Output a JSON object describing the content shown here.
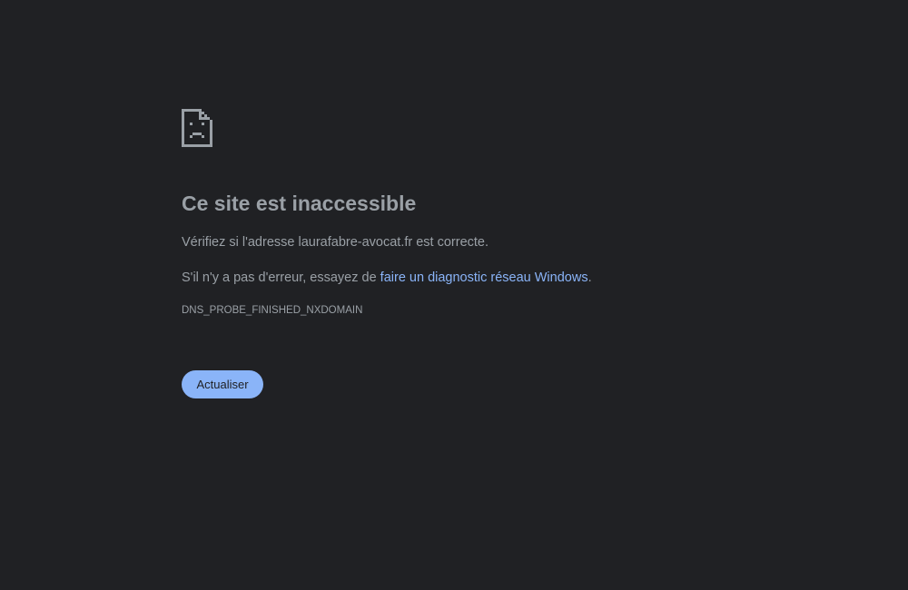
{
  "error_page": {
    "icon": "sad-page-icon",
    "title": "Ce site est inaccessible",
    "check_text": "Vérifiez si l'adresse laurafabre-avocat.fr est correcte.",
    "suggestion_prefix": "S'il n'y a pas d'erreur, essayez de ",
    "diagnostic_link": "faire un diagnostic réseau Windows",
    "suggestion_suffix": ".",
    "error_code": "DNS_PROBE_FINISHED_NXDOMAIN",
    "reload_button": "Actualiser"
  },
  "colors": {
    "background": "#202124",
    "text": "#9aa0a6",
    "link": "#8ab4f8",
    "button_bg": "#8ab4f8",
    "button_text": "#202124"
  }
}
